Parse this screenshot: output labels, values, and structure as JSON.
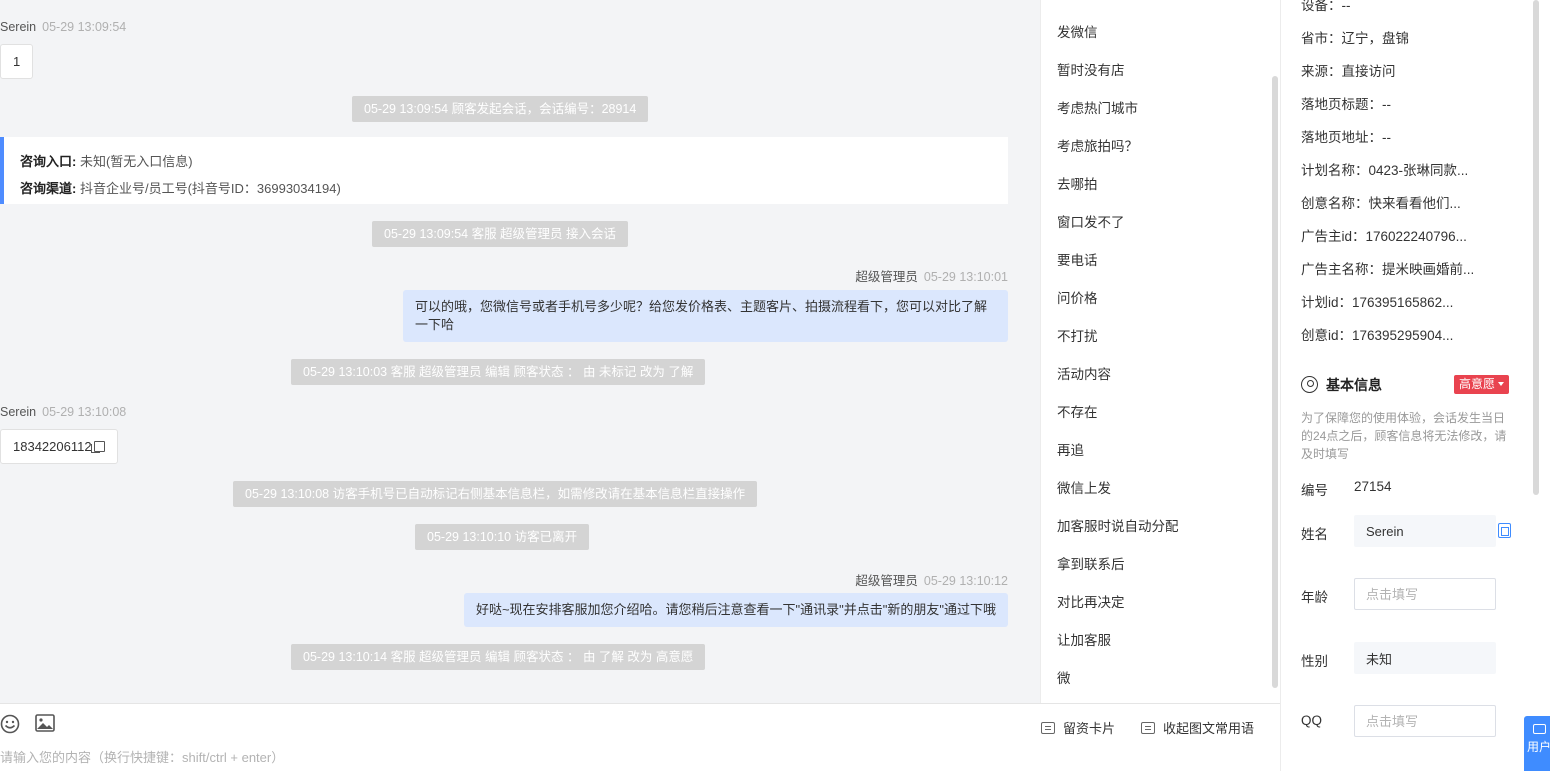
{
  "chat": {
    "msg1": {
      "sender": "Serein",
      "time": "05-29 13:09:54",
      "content": "1"
    },
    "sys1": "05-29 13:09:54 顾客发起会话，会话编号：28914",
    "consult": {
      "entry_label": "咨询入口:",
      "entry_value": "未知(暂无入口信息)",
      "channel_label": "咨询渠道:",
      "channel_value": "抖音企业号/员工号(抖音号ID：36993034194)"
    },
    "sys2": "05-29 13:09:54 客服 超级管理员 接入会话",
    "msg2": {
      "sender": "超级管理员",
      "time": "05-29 13:10:01",
      "content": "可以的哦，您微信号或者手机号多少呢？给您发价格表、主题客片、拍摄流程看下，您可以对比了解一下哈"
    },
    "sys3": "05-29 13:10:03 客服 超级管理员 编辑 顾客状态 ： 由 未标记 改为 了解",
    "msg3": {
      "sender": "Serein",
      "time": "05-29 13:10:08",
      "content": "18342206112"
    },
    "sys4": "05-29 13:10:08 访客手机号已自动标记右侧基本信息栏，如需修改请在基本信息栏直接操作",
    "sys5": "05-29 13:10:10 访客已离开",
    "msg4": {
      "sender": "超级管理员",
      "time": "05-29 13:10:12",
      "content": "好哒~现在安排客服加您介绍哈。请您稍后注意查看一下\"通讯录\"并点击\"新的朋友\"通过下哦"
    },
    "sys6": "05-29 13:10:14 客服 超级管理员 编辑 顾客状态 ： 由 了解 改为 高意愿"
  },
  "quick_replies": [
    "发微信",
    "暂时没有店",
    "考虑热门城市",
    "考虑旅拍吗？",
    "去哪拍",
    "窗口发不了",
    "要电话",
    "问价格",
    "不打扰",
    "活动内容",
    "不存在",
    "再追",
    "微信上发",
    "加客服时说自动分配",
    "拿到联系后",
    "对比再决定",
    "让加客服",
    "微"
  ],
  "input": {
    "card_label": "留资卡片",
    "collapse_label": "收起图文常用语",
    "placeholder": "请输入您的内容（换行快捷键：shift/ctrl + enter）"
  },
  "info": {
    "device": "设备：--",
    "rows": [
      "省市：辽宁，盘锦",
      "来源：直接访问",
      "落地页标题：--",
      "落地页地址：--",
      "计划名称：0423-张琳同款...",
      "创意名称：快来看看他们...",
      "广告主id：176022240796...",
      "广告主名称：提米映画婚前...",
      "计划id：176395165862...",
      "创意id：176395295904..."
    ],
    "basic_title": "基本信息",
    "intent_badge": "高意愿",
    "note": "为了保障您的使用体验，会话发生当日的24点之后，顾客信息将无法修改，请及时填写",
    "id_label": "编号",
    "id_value": "27154",
    "name_label": "姓名",
    "name_value": "Serein",
    "age_label": "年龄",
    "age_placeholder": "点击填写",
    "gender_label": "性别",
    "gender_value": "未知",
    "qq_label": "QQ",
    "qq_placeholder": "点击填写",
    "side_button": "用户"
  }
}
